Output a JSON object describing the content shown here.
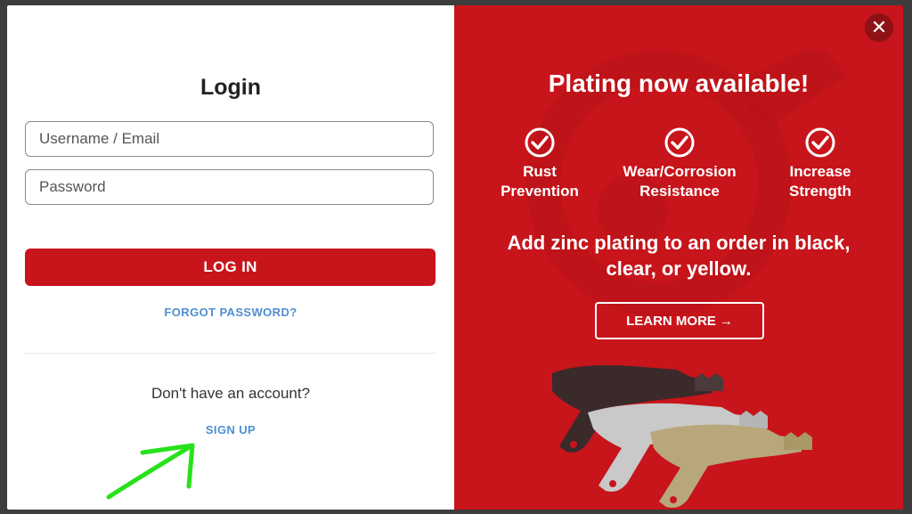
{
  "login": {
    "title": "Login",
    "username_placeholder": "Username / Email",
    "password_placeholder": "Password",
    "login_button": "LOG IN",
    "forgot_password": "FORGOT PASSWORD?",
    "no_account_text": "Don't have an account?",
    "signup_link": "SIGN UP"
  },
  "promo": {
    "close_icon": "close-icon",
    "title": "Plating now available!",
    "benefits": [
      {
        "icon": "check-circle-icon",
        "line1": "Rust",
        "line2": "Prevention"
      },
      {
        "icon": "check-circle-icon",
        "line1": "Wear/Corrosion",
        "line2": "Resistance"
      },
      {
        "icon": "check-circle-icon",
        "line1": "Increase",
        "line2": "Strength"
      }
    ],
    "message_line1": "Add zinc plating to an order in black,",
    "message_line2": "clear, or yellow.",
    "learn_more": "LEARN MORE",
    "arrow_icon": "arrow-right-icon"
  },
  "colors": {
    "brand_red": "#c8141b",
    "link_blue": "#4f8fd1",
    "annotation_green": "#27e21b"
  }
}
